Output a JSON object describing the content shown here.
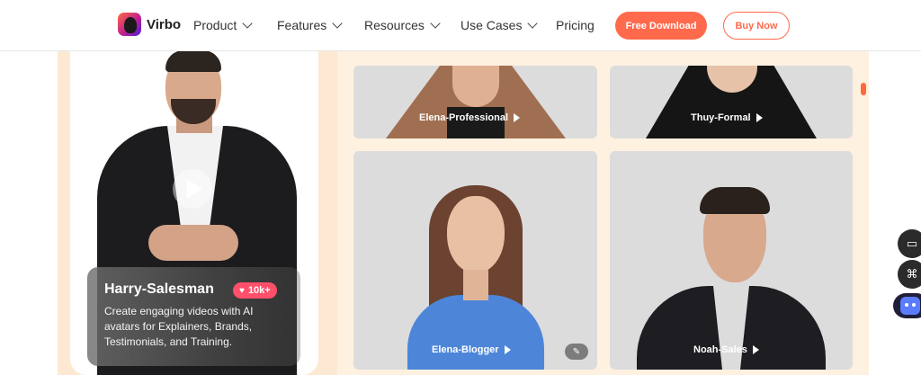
{
  "nav": {
    "brand": "Virbo",
    "items": [
      {
        "label": "Product"
      },
      {
        "label": "Features"
      },
      {
        "label": "Resources"
      },
      {
        "label": "Use Cases"
      }
    ],
    "pricing": "Pricing",
    "free_download": "Free Download",
    "buy_now": "Buy Now"
  },
  "featured": {
    "name": "Harry-Salesman",
    "likes": "10k+",
    "description": "Create engaging videos with AI avatars for Explainers, Brands, Testimonials, and Training."
  },
  "avatars": [
    {
      "label": "Elena-Professional"
    },
    {
      "label": "Thuy-Formal"
    },
    {
      "label": "Elena-Blogger"
    },
    {
      "label": "Noah-Sales"
    }
  ],
  "icons": {
    "book": "book-icon",
    "apps": "apps-grid-icon",
    "bot": "chatbot-icon"
  },
  "colors": {
    "accent": "#ff6a4d",
    "like_badge": "#ff4f6a",
    "panel_bg": "#fde9d3"
  }
}
